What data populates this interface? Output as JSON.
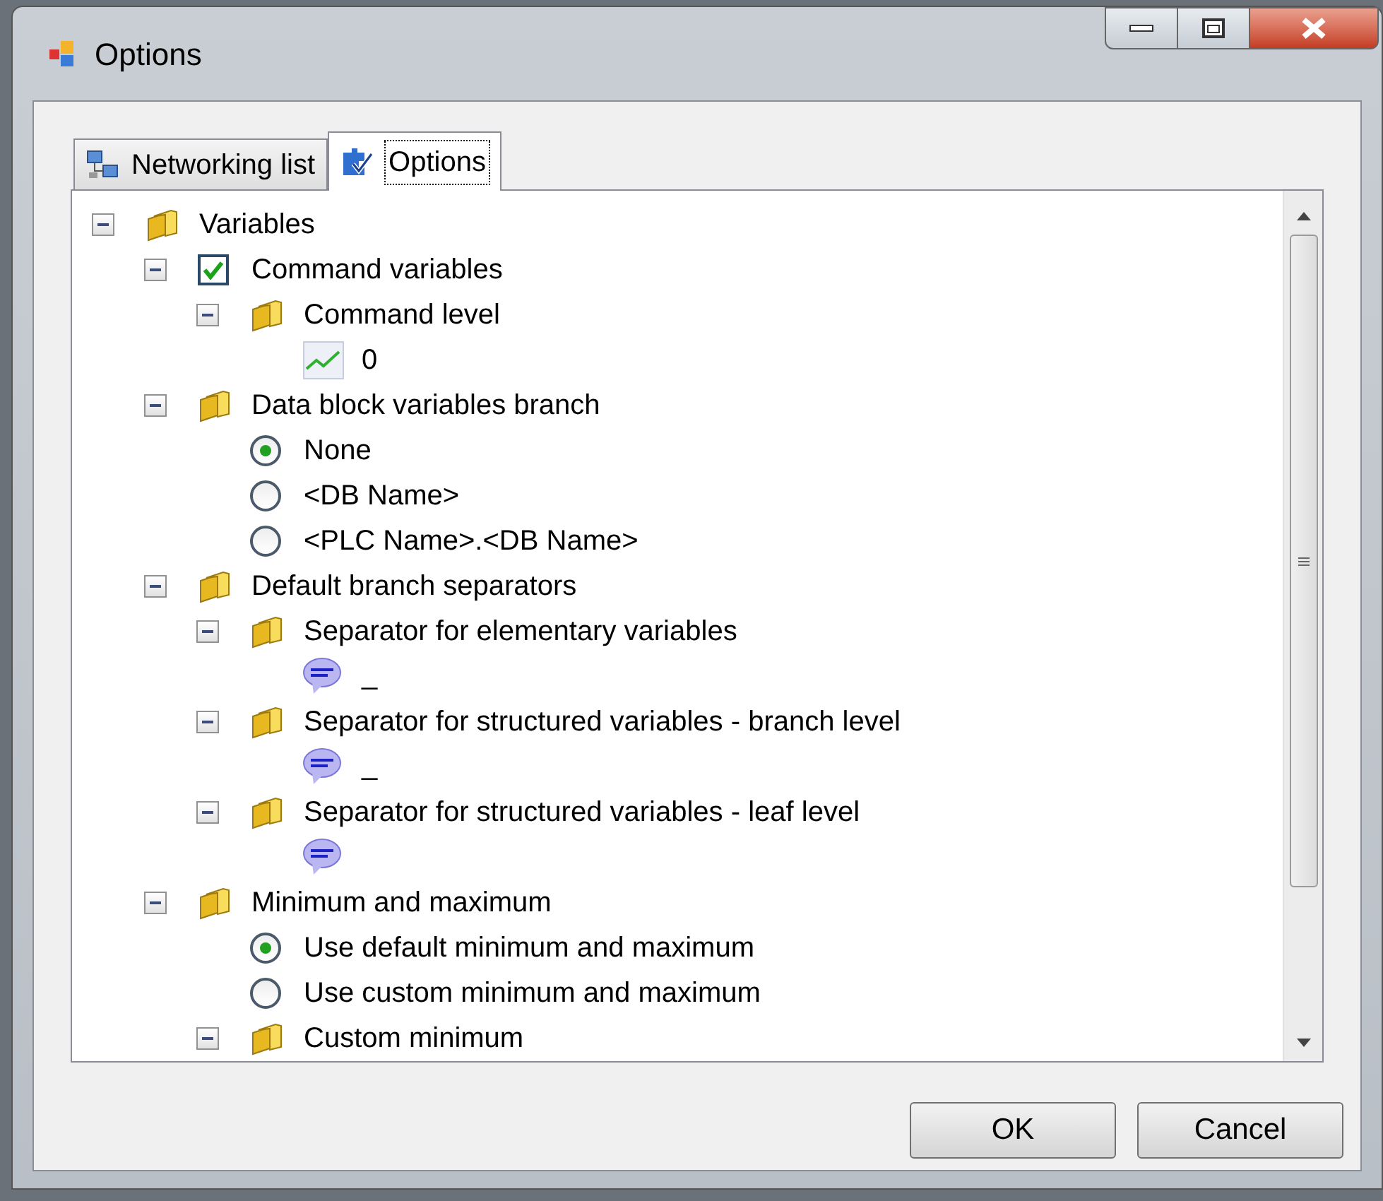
{
  "window": {
    "title": "Options"
  },
  "tabs": [
    {
      "label": "Networking list",
      "selected": false
    },
    {
      "label": "Options",
      "selected": true
    }
  ],
  "tree": [
    {
      "kind": "folder",
      "label": "Variables",
      "expanded": true,
      "children": [
        {
          "kind": "checkbox",
          "label": "Command variables",
          "checked": true,
          "expanded": true,
          "children": [
            {
              "kind": "folder",
              "label": "Command level",
              "expanded": true,
              "children": [
                {
                  "kind": "number",
                  "label": "0"
                }
              ]
            }
          ]
        },
        {
          "kind": "folder",
          "label": "Data block variables branch",
          "expanded": true,
          "children": [
            {
              "kind": "radio",
              "label": "None",
              "selected": true
            },
            {
              "kind": "radio",
              "label": "<DB Name>",
              "selected": false
            },
            {
              "kind": "radio",
              "label": "<PLC Name>.<DB Name>",
              "selected": false
            }
          ]
        },
        {
          "kind": "folder",
          "label": "Default branch separators",
          "expanded": true,
          "children": [
            {
              "kind": "folder",
              "label": "Separator for elementary variables",
              "expanded": true,
              "children": [
                {
                  "kind": "text",
                  "label": "_"
                }
              ]
            },
            {
              "kind": "folder",
              "label": "Separator for structured variables - branch level",
              "expanded": true,
              "children": [
                {
                  "kind": "text",
                  "label": "_"
                }
              ]
            },
            {
              "kind": "folder",
              "label": "Separator for structured variables - leaf level",
              "expanded": true,
              "children": [
                {
                  "kind": "text"
                }
              ]
            }
          ]
        },
        {
          "kind": "folder",
          "label": "Minimum and maximum",
          "expanded": true,
          "children": [
            {
              "kind": "radio",
              "label": "Use default minimum and maximum",
              "selected": true
            },
            {
              "kind": "radio",
              "label": "Use custom minimum and maximum",
              "selected": false
            },
            {
              "kind": "folder",
              "label": "Custom minimum",
              "expanded": true
            }
          ]
        }
      ]
    }
  ],
  "buttons": [
    "OK",
    "Cancel"
  ]
}
